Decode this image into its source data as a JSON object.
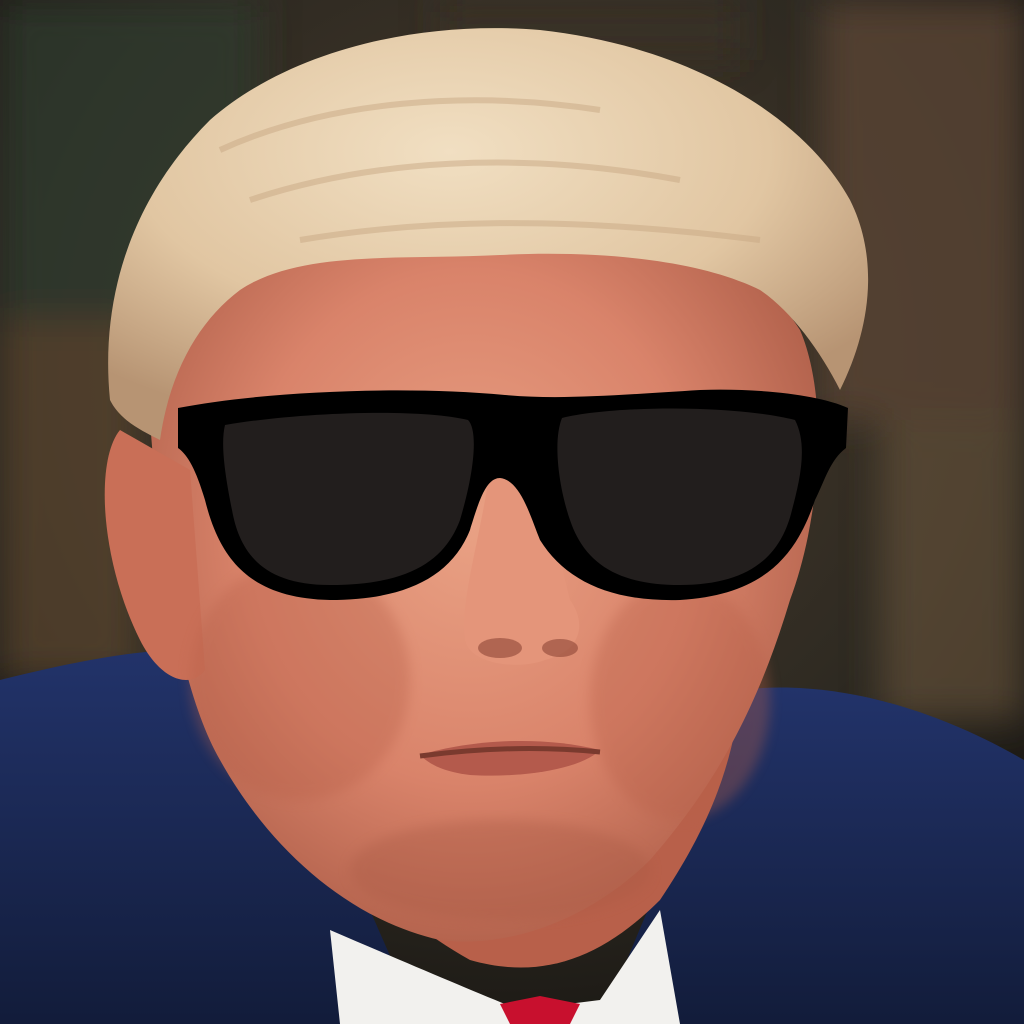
{
  "photo": {
    "subject": "portrait",
    "overlay": "sunglasses"
  },
  "colors": {
    "background_dark": "#1e1a16",
    "background_warm": "#4a3a2a",
    "background_green": "#2e3a2c",
    "skin": "#d9836a",
    "skin_shadow": "#b8604a",
    "skin_highlight": "#e9a184",
    "hair": "#e6cfae",
    "hair_shadow": "#c7a784",
    "suit": "#1d2b55",
    "suit_shadow": "#121c3a",
    "shirt": "#f2f1ee",
    "tie": "#c8102e",
    "glasses_frame": "#000000",
    "glasses_lens": "#231f1e"
  }
}
